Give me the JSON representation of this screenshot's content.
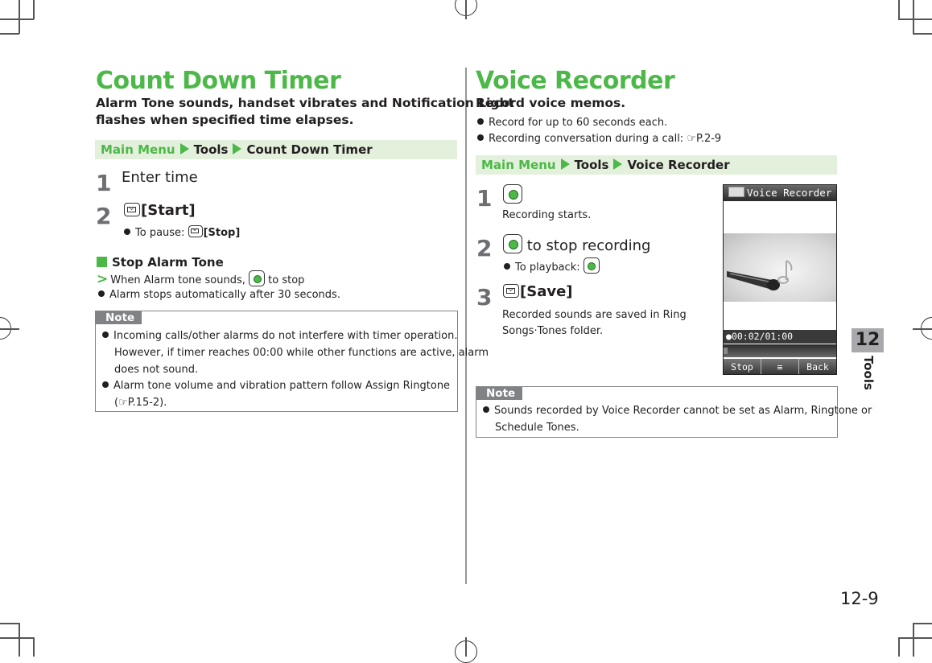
{
  "left": {
    "title": "Count Down Timer",
    "lead_line1": "Alarm Tone sounds, handset vibrates and Notification Light",
    "lead_line2": "flashes when specified time elapses.",
    "path": [
      "Main Menu",
      "Tools",
      "Count Down Timer"
    ],
    "steps": [
      {
        "num": "1",
        "text": "Enter time"
      },
      {
        "num": "2",
        "label": "[Start]",
        "key": "mail-key-icon",
        "sub_prefix": "To pause:",
        "sub_label": "[Stop]"
      }
    ],
    "subsection": {
      "title": "Stop Alarm Tone",
      "action_prefix": "When Alarm tone sounds,",
      "action_suffix": "to stop",
      "bullet": "Alarm stops automatically after 30 seconds."
    },
    "note": {
      "tag": "Note",
      "items": [
        {
          "lines": [
            "Incoming calls/other alarms do not interfere with timer operation.",
            "However, if timer reaches 00:00 while other functions are active, alarm",
            "does not sound."
          ]
        },
        {
          "lines": [
            "Alarm tone volume and vibration pattern follow Assign Ringtone",
            "P.15-2)."
          ],
          "ref_prefix": "("
        }
      ]
    }
  },
  "right": {
    "title": "Voice Recorder",
    "lead": "Record voice memos.",
    "bullets": [
      "Record for up to 60 seconds each.",
      "Recording conversation during a call:"
    ],
    "bullet2_ref": "P.2-9",
    "path": [
      "Main Menu",
      "Tools",
      "Voice Recorder"
    ],
    "steps": [
      {
        "num": "1",
        "key": "center-key-icon",
        "desc": "Recording starts."
      },
      {
        "num": "2",
        "key": "center-key-icon",
        "text": "to stop recording",
        "sub_prefix": "To playback:"
      },
      {
        "num": "3",
        "key": "mail-key-icon",
        "label": "[Save]",
        "desc_line1": "Recorded sounds are saved in Ring",
        "desc_line2": "Songs·Tones folder."
      }
    ],
    "phone": {
      "title": "Voice Recorder",
      "time": "00:02/01:00",
      "progress_fraction": 0.033,
      "softkeys": [
        "Stop",
        "≡",
        "Back"
      ]
    },
    "note": {
      "tag": "Note",
      "lines": [
        "Sounds recorded by Voice Recorder cannot be set as Alarm, Ringtone or",
        "Schedule Tones."
      ]
    }
  },
  "chapter": {
    "number": "12",
    "label": "Tools"
  },
  "page_number": "12-9",
  "colors": {
    "accent": "#4cb848",
    "path_bg": "#e3f0dc",
    "note_gray": "#808285"
  }
}
